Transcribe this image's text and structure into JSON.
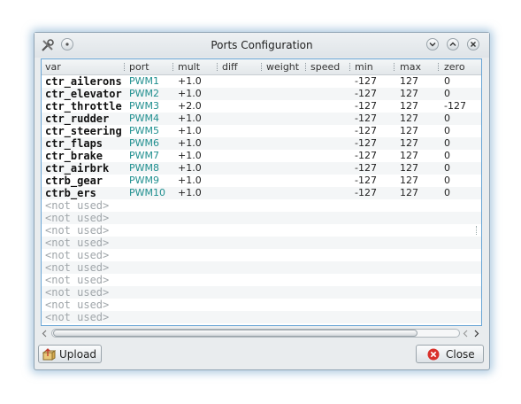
{
  "window": {
    "title": "Ports Configuration"
  },
  "table": {
    "columns": [
      "var",
      "port",
      "mult",
      "diff",
      "weight",
      "speed",
      "min",
      "max",
      "zero"
    ],
    "rows": [
      {
        "var": "ctr_ailerons",
        "port": "PWM1",
        "mult": "+1.0",
        "min": "-127",
        "max": "127",
        "zero": "0"
      },
      {
        "var": "ctr_elevator",
        "port": "PWM2",
        "mult": "+1.0",
        "min": "-127",
        "max": "127",
        "zero": "0"
      },
      {
        "var": "ctr_throttle",
        "port": "PWM3",
        "mult": "+2.0",
        "min": "-127",
        "max": "127",
        "zero": "-127"
      },
      {
        "var": "ctr_rudder",
        "port": "PWM4",
        "mult": "+1.0",
        "min": "-127",
        "max": "127",
        "zero": "0"
      },
      {
        "var": "ctr_steering",
        "port": "PWM5",
        "mult": "+1.0",
        "min": "-127",
        "max": "127",
        "zero": "0"
      },
      {
        "var": "ctr_flaps",
        "port": "PWM6",
        "mult": "+1.0",
        "min": "-127",
        "max": "127",
        "zero": "0"
      },
      {
        "var": "ctr_brake",
        "port": "PWM7",
        "mult": "+1.0",
        "min": "-127",
        "max": "127",
        "zero": "0"
      },
      {
        "var": "ctr_airbrk",
        "port": "PWM8",
        "mult": "+1.0",
        "min": "-127",
        "max": "127",
        "zero": "0"
      },
      {
        "var": "ctrb_gear",
        "port": "PWM9",
        "mult": "+1.0",
        "min": "-127",
        "max": "127",
        "zero": "0"
      },
      {
        "var": "ctrb_ers",
        "port": "PWM10",
        "mult": "+1.0",
        "min": "-127",
        "max": "127",
        "zero": "0"
      },
      {
        "var": "<not used>"
      },
      {
        "var": "<not used>"
      },
      {
        "var": "<not used>"
      },
      {
        "var": "<not used>"
      },
      {
        "var": "<not used>"
      },
      {
        "var": "<not used>"
      },
      {
        "var": "<not used>"
      },
      {
        "var": "<not used>"
      },
      {
        "var": "<not used>"
      },
      {
        "var": "<not used>"
      }
    ]
  },
  "buttons": {
    "upload": "Upload",
    "close": "Close"
  },
  "icons": {
    "app": "tools-icon",
    "menu": "circle-menu-icon",
    "minimize": "chevron-down-icon",
    "maximize": "chevron-up-icon",
    "close": "close-icon",
    "upload": "upload-icon",
    "close_button": "close-circle-icon"
  },
  "colors": {
    "port_text": "#1f8f8f",
    "unused_text": "#a0a6aa",
    "frame_border": "#6aa6d6",
    "close_icon": "#d9302a"
  }
}
